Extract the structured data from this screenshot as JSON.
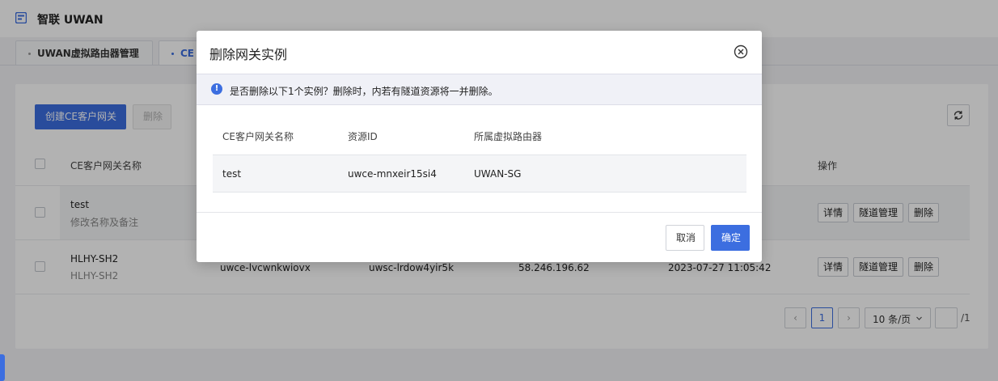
{
  "app": {
    "title": "智联 UWAN",
    "logo_icon": "router-logo-icon"
  },
  "tabs": [
    {
      "label": "UWAN虚拟路由器管理",
      "active": false
    },
    {
      "label": "CE",
      "active": true
    }
  ],
  "toolbar": {
    "create_label": "创建CE客户网关",
    "delete_label": "删除",
    "refresh_icon": "refresh-icon"
  },
  "table": {
    "headers": {
      "name": "CE客户网关名称",
      "actions": "操作"
    },
    "rows": [
      {
        "name": "test",
        "remark": "修改名称及备注",
        "id": "",
        "router": "",
        "ip": "",
        "time": "",
        "actions": [
          "详情",
          "隧道管理",
          "删除"
        ]
      },
      {
        "name": "HLHY-SH2",
        "remark": "HLHY-SH2",
        "id": "uwce-lvcwnkwiovx",
        "router": "uwsc-lrdow4yir5k",
        "ip": "58.246.196.62",
        "time": "2023-07-27 11:05:42",
        "actions": [
          "详情",
          "隧道管理",
          "删除"
        ]
      }
    ]
  },
  "pagination": {
    "prev": "‹",
    "current": "1",
    "next": "›",
    "page_size": "10 条/页",
    "jump_value": "",
    "total_pages": "/1"
  },
  "dialog": {
    "title": "删除网关实例",
    "close_icon": "close-circle-icon",
    "alert_icon": "info-icon",
    "alert_text": "是否删除以下1个实例？删除时，内若有隧道资源将一并删除。",
    "headers": [
      "CE客户网关名称",
      "资源ID",
      "所属虚拟路由器"
    ],
    "rows": [
      {
        "name": "test",
        "id": "uwce-mnxeir15si4",
        "router": "UWAN-SG"
      }
    ],
    "cancel_label": "取消",
    "confirm_label": "确定"
  },
  "colors": {
    "primary": "#3c6ee0",
    "mask": "rgba(0,0,0,0.30)"
  }
}
